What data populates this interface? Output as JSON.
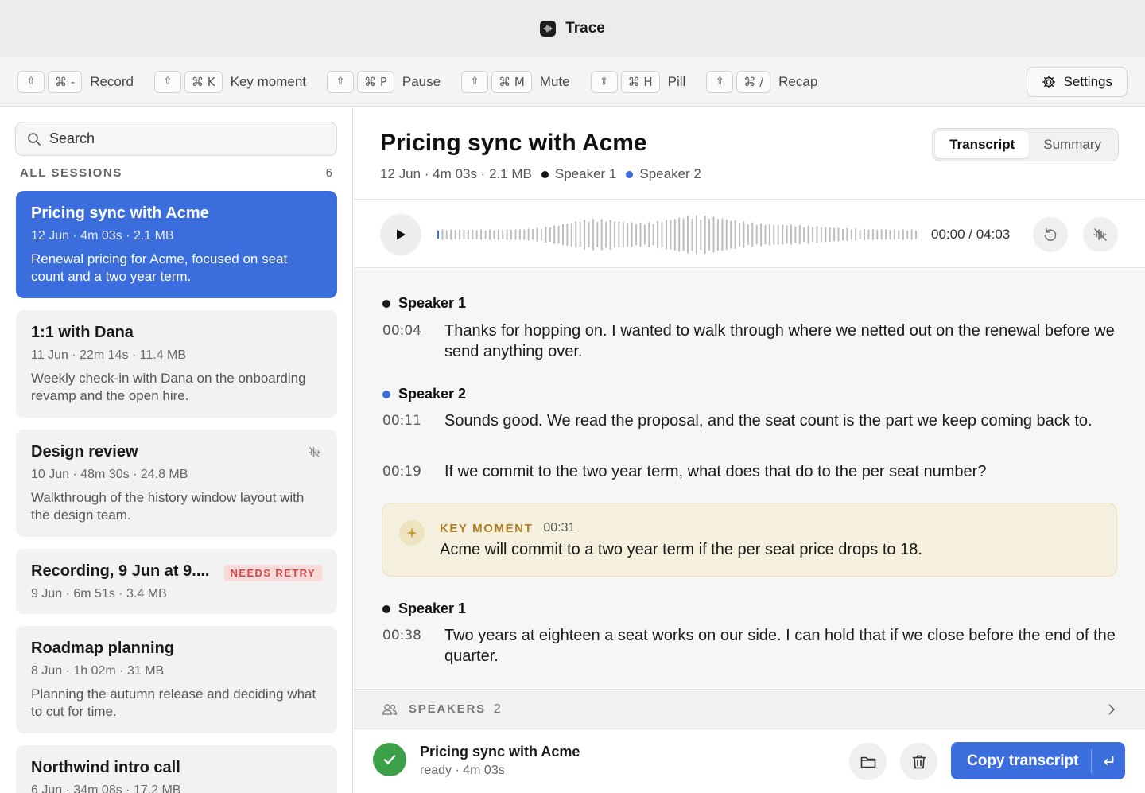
{
  "app": {
    "title": "Trace"
  },
  "shortcuts": [
    {
      "mod": "⇧",
      "key": "⌘ -",
      "label": "Record"
    },
    {
      "mod": "⇧",
      "key": "⌘ K",
      "label": "Key moment"
    },
    {
      "mod": "⇧",
      "key": "⌘ P",
      "label": "Pause"
    },
    {
      "mod": "⇧",
      "key": "⌘ M",
      "label": "Mute"
    },
    {
      "mod": "⇧",
      "key": "⌘ H",
      "label": "Pill"
    },
    {
      "mod": "⇧",
      "key": "⌘ /",
      "label": "Recap"
    }
  ],
  "settings_label": "Settings",
  "sidebar": {
    "search_placeholder": "Search",
    "section_title": "ALL SESSIONS",
    "section_count": "6",
    "sessions": [
      {
        "title": "Pricing sync with Acme",
        "meta": "12 Jun · 4m 03s · 2.1 MB",
        "desc": "Renewal pricing for Acme, focused on seat count and a two year term."
      },
      {
        "title": "1:1 with Dana",
        "meta": "11 Jun · 22m 14s · 11.4 MB",
        "desc": "Weekly check-in with Dana on the onboarding revamp and the open hire."
      },
      {
        "title": "Design review",
        "meta": "10 Jun · 48m 30s · 24.8 MB",
        "desc": "Walkthrough of the history window layout with the design team.",
        "icon": "muted-waveform-icon"
      },
      {
        "title": "Recording, 9 Jun at 9....",
        "meta": "9 Jun · 6m 51s · 3.4 MB",
        "badge": "NEEDS RETRY"
      },
      {
        "title": "Roadmap planning",
        "meta": "8 Jun · 1h 02m · 31 MB",
        "desc": "Planning the autumn release and deciding what to cut for time."
      },
      {
        "title": "Northwind intro call",
        "meta": "6 Jun · 34m 08s · 17.2 MB"
      }
    ]
  },
  "detail": {
    "title": "Pricing sync with Acme",
    "meta": "12 Jun · 4m 03s · 2.1 MB",
    "speaker1": "Speaker 1",
    "speaker2": "Speaker 2",
    "tabs": {
      "transcript": "Transcript",
      "summary": "Summary"
    },
    "time": "00:00 / 04:03",
    "transcript": [
      {
        "speaker": "Speaker 1",
        "lines": [
          {
            "ts": "00:04",
            "text": "Thanks for hopping on. I wanted to walk through where we netted out on the renewal before we send anything over."
          }
        ]
      },
      {
        "speaker": "Speaker 2",
        "lines": [
          {
            "ts": "00:11",
            "text": "Sounds good. We read the proposal, and the seat count is the part we keep coming back to."
          },
          {
            "ts": "00:19",
            "text": "If we commit to the two year term, what does that do to the per seat number?"
          }
        ]
      },
      {
        "speaker": "Speaker 1",
        "lines": [
          {
            "ts": "00:38",
            "text": "Two years at eighteen a seat works on our side. I can hold that if we close before the end of the quarter."
          }
        ]
      }
    ],
    "key_moment": {
      "label": "KEY MOMENT",
      "ts": "00:31",
      "text": "Acme will commit to a two year term if the per seat price drops to 18."
    },
    "speakers_bar": {
      "label": "SPEAKERS",
      "count": "2"
    },
    "footer": {
      "title": "Pricing sync with Acme",
      "status": "ready · 4m 03s",
      "copy_label": "Copy transcript"
    }
  },
  "colors": {
    "accent": "#3b6ddc",
    "success": "#3ba048",
    "key_moment_bg": "#f5f0dd",
    "key_moment_label": "#b07d22",
    "badge_text": "#d04545"
  }
}
